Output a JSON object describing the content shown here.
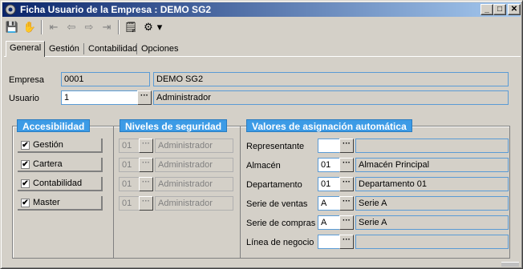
{
  "window": {
    "title": "Ficha Usuario de la Empresa : DEMO SG2"
  },
  "titlebar_buttons": {
    "minimize": "_",
    "maximize": "□",
    "close": "✕"
  },
  "toolbar": {
    "items": [
      "save-icon",
      "hand-icon",
      "first-icon",
      "previous-icon",
      "next-icon",
      "last-icon",
      "notes-icon",
      "settings-icon",
      "dropdown-arrow-icon"
    ],
    "glyphs": {
      "save": "💾",
      "hand": "✋",
      "first": "⇤",
      "prev": "⇦",
      "next": "⇨",
      "last": "⇥",
      "notes": "🗒",
      "settings": "⚙",
      "dropdown": "▾"
    }
  },
  "tabs": [
    {
      "label": "General",
      "selected": true
    },
    {
      "label": "Gestión",
      "selected": false
    },
    {
      "label": "Contabilidad",
      "selected": false
    },
    {
      "label": "Opciones",
      "selected": false
    }
  ],
  "empresa": {
    "label": "Empresa",
    "code": "0001",
    "name": "DEMO SG2"
  },
  "usuario": {
    "label": "Usuario",
    "code": "1",
    "name": "Administrador",
    "ellipsis": "···"
  },
  "accesibilidad": {
    "title": "Accesibilidad",
    "items": [
      {
        "label": "Gestión",
        "checked": true,
        "mark": "✔"
      },
      {
        "label": "Cartera",
        "checked": true,
        "mark": "✔"
      },
      {
        "label": "Contabilidad",
        "checked": true,
        "mark": "✔"
      },
      {
        "label": "Master",
        "checked": true,
        "mark": "✔"
      }
    ]
  },
  "niveles": {
    "title": "Niveles de seguridad",
    "rows": [
      {
        "code": "01",
        "name": "Administrador"
      },
      {
        "code": "01",
        "name": "Administrador"
      },
      {
        "code": "01",
        "name": "Administrador"
      },
      {
        "code": "01",
        "name": "Administrador"
      }
    ]
  },
  "valores": {
    "title": "Valores de asignación automática",
    "rows": [
      {
        "label": "Representante",
        "code": "",
        "name": ""
      },
      {
        "label": "Almacén",
        "code": "01",
        "name": "Almacén Principal"
      },
      {
        "label": "Departamento",
        "code": "01",
        "name": "Departamento 01"
      },
      {
        "label": "Serie de ventas",
        "code": "A",
        "name": "Serie A"
      },
      {
        "label": "Serie de compras",
        "code": "A",
        "name": "Serie A"
      },
      {
        "label": "Línea de negocio",
        "code": "",
        "name": ""
      }
    ]
  },
  "colors": {
    "accent": "#3c9be6",
    "titlebar_start": "#0a246a",
    "titlebar_end": "#a6caf0",
    "window_bg": "#d4d0c8"
  }
}
